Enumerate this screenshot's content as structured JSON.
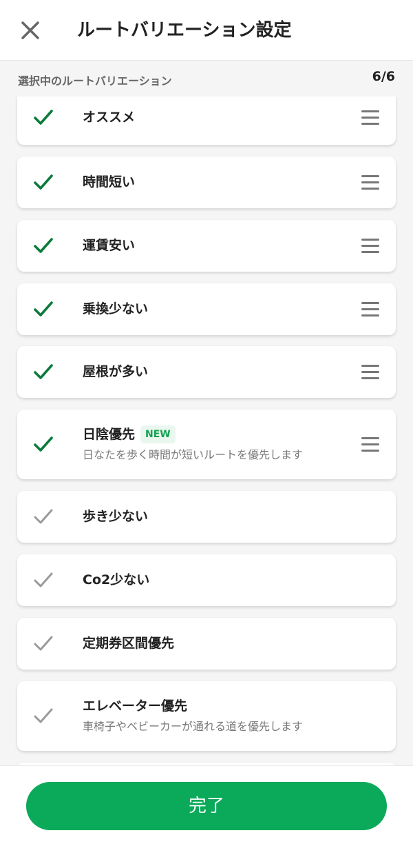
{
  "header": {
    "title": "ルートバリエーション設定",
    "close_icon": "close-icon"
  },
  "subheader": {
    "label": "選択中のルートバリエーション",
    "count": "6/6"
  },
  "colors": {
    "check_active": "#0b7a3b",
    "check_inactive": "#9a9a9a",
    "primary_button": "#0aaa5a",
    "badge_bg": "#e9f7ee",
    "badge_text": "#12a150"
  },
  "items": [
    {
      "label": "オススメ",
      "selected": true,
      "badge": "",
      "desc": ""
    },
    {
      "label": "時間短い",
      "selected": true,
      "badge": "",
      "desc": ""
    },
    {
      "label": "運賃安い",
      "selected": true,
      "badge": "",
      "desc": ""
    },
    {
      "label": "乗換少ない",
      "selected": true,
      "badge": "",
      "desc": ""
    },
    {
      "label": "屋根が多い",
      "selected": true,
      "badge": "",
      "desc": ""
    },
    {
      "label": "日陰優先",
      "selected": true,
      "badge": "NEW",
      "desc": "日なたを歩く時間が短いルートを優先します"
    },
    {
      "label": "歩き少ない",
      "selected": false,
      "badge": "",
      "desc": ""
    },
    {
      "label": "Co2少ない",
      "selected": false,
      "badge": "",
      "desc": ""
    },
    {
      "label": "定期券区間優先",
      "selected": false,
      "badge": "",
      "desc": ""
    },
    {
      "label": "エレベーター優先",
      "selected": false,
      "badge": "",
      "desc": "車椅子やベビーカーが通れる道を優先します"
    }
  ],
  "footer": {
    "done_label": "完了"
  }
}
